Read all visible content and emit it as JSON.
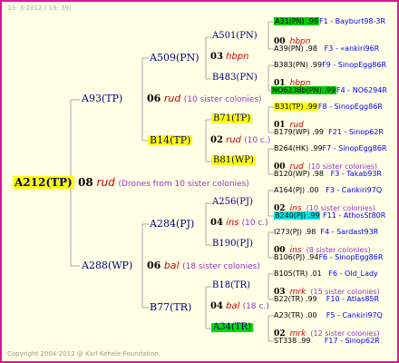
{
  "header": "13-  3-2012 ( 19: 39)",
  "copyright": "Copyright 2004-2012 @ Karl Kehele Foundation.",
  "root": {
    "queen": "A212(TP)",
    "num": "08",
    "name": "rud",
    "note": "(Drones from 10 sister colonies)"
  },
  "gen2": [
    {
      "queen": "A93(TP)",
      "num": "06",
      "name": "rud",
      "note": "(10 sister colonies)"
    },
    {
      "queen": "A288(WP)",
      "num": "06",
      "name": "bal",
      "note": "(18 sister colonies)"
    }
  ],
  "gen3": [
    {
      "queen": "A509(PN)",
      "num": "03",
      "name": "hbpn",
      "note": ""
    },
    {
      "queen": "B14(TP)",
      "num": "02",
      "name": "rud",
      "note": "(10 c.)"
    },
    {
      "queen": "A284(PJ)",
      "num": "04",
      "name": "ins",
      "note": "(10 c.)"
    },
    {
      "queen": "B77(TR)",
      "num": "04",
      "name": "bal",
      "note": "(18 c.)"
    }
  ],
  "gen4": [
    {
      "queen": "A501(PN)",
      "num": "00",
      "name": "hbpn",
      "note": ""
    },
    {
      "queen": "B483(PN)",
      "num": "01",
      "name": "hbpn",
      "note": ""
    },
    {
      "queen": "B71(TP)",
      "num": "01",
      "name": "rud",
      "note": ""
    },
    {
      "queen": "B81(WP)",
      "num": "00",
      "name": "rud",
      "note": "(10 sister colonies)"
    },
    {
      "queen": "A256(PJ)",
      "num": "02",
      "name": "ins",
      "note": "(10 sister colonies)"
    },
    {
      "queen": "B190(PJ)",
      "num": "00",
      "name": "ins",
      "note": "(8 sister colonies)"
    },
    {
      "queen": "B18(TR)",
      "num": "03",
      "name": "mrk",
      "note": "(15 sister colonies)"
    },
    {
      "queen": "A34(TR)",
      "num": "02",
      "name": "mrk",
      "note": "(12 sister colonies)"
    }
  ],
  "gen5": [
    {
      "pn": "A31(PN) .99",
      "pr": "F1 - Bayburt98-3R"
    },
    {
      "pn": "A39(PN) .98",
      "pr": "F3 - «ankiri96R"
    },
    {
      "pn": "B383(PN) .99",
      "pr": "F9 - SinopEgg86R"
    },
    {
      "pn": "NO6238b(PN) .99",
      "pr": "F4 - NO6294R"
    },
    {
      "pn": "B31(TP) .99",
      "pr": "F8 - SinopEgg86R"
    },
    {
      "pn": "B179(WP) .99",
      "pr": "F21 - Sinop62R"
    },
    {
      "pn": "B264(HK) .99",
      "pr": "F7 - SinopEgg86R"
    },
    {
      "pn": "B120(WP) .98",
      "pr": "F3 - Takab93R"
    },
    {
      "pn": "A164(PJ) .00",
      "pr": "F3 - Cankiri97Q"
    },
    {
      "pn": "B240(PJ) .99",
      "pr": "F11 - AthosSt80R"
    },
    {
      "pn": "I273(PJ) .98",
      "pr": "F4 - Sardast93R"
    },
    {
      "pn": "B106(PJ) .94",
      "pr": "F6 - SinopEgg86R"
    },
    {
      "pn": "B105(TR) .01",
      "pr": "F6 - Old_Lady"
    },
    {
      "pn": "B22(TR) .99",
      "pr": "F10 - Atlas85R"
    },
    {
      "pn": "A23(TR) .00",
      "pr": "F5 - Cankiri97Q"
    },
    {
      "pn": "ST338 .99",
      "pr": "F17 - Sinop62R"
    }
  ],
  "colors": {
    "border": "#e0149a",
    "background": "#ffffe6",
    "highlight_yellow": "#ffff00",
    "highlight_green": "#00cc00",
    "highlight_cyan": "#00e5e5",
    "lines": "#aaaaaa"
  }
}
